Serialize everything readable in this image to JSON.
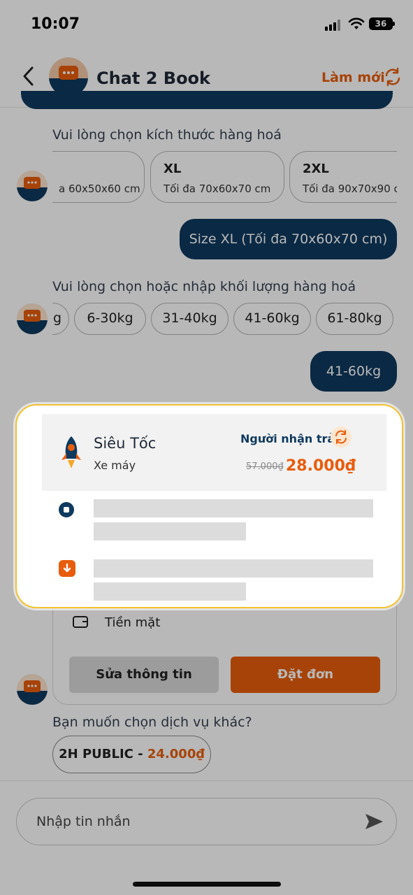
{
  "status_bar": {
    "time": "10:07",
    "battery": "36"
  },
  "header": {
    "title": "Chat 2 Book",
    "refresh_label": "Làm mới"
  },
  "size_section": {
    "prompt": "Vui lòng chọn kích thước hàng hoá",
    "options": [
      {
        "name": "",
        "desc": "a 60x50x60 cm"
      },
      {
        "name": "XL",
        "desc": "Tối đa 70x60x70 cm"
      },
      {
        "name": "2XL",
        "desc": "Tối đa 90x70x90 c"
      }
    ],
    "selected_reply": "Size XL (Tối đa 70x60x70 cm)"
  },
  "weight_section": {
    "prompt": "Vui lòng chọn hoặc nhập khối lượng hàng hoá",
    "options": [
      "g",
      "6-30kg",
      "31-40kg",
      "41-60kg",
      "61-80kg"
    ],
    "selected_reply": "41-60kg"
  },
  "order": {
    "service_name": "Siêu Tốc",
    "vehicle": "Xe máy",
    "payer": "Người nhận trả",
    "old_price": "57.000₫",
    "new_price": "28.000₫",
    "payment_method": "Tiền mặt",
    "edit_label": "Sửa thông tin",
    "order_label": "Đặt đơn"
  },
  "alternatives": {
    "prompt": "Bạn muốn chọn dịch vụ khác?",
    "service": "2H PUBLIC - ",
    "price": "24.000₫"
  },
  "composer": {
    "placeholder": "Nhập tin nhắn"
  },
  "colors": {
    "brand_orange": "#e85d0c",
    "navy": "#0f3a5f",
    "highlight": "#f2c230"
  }
}
